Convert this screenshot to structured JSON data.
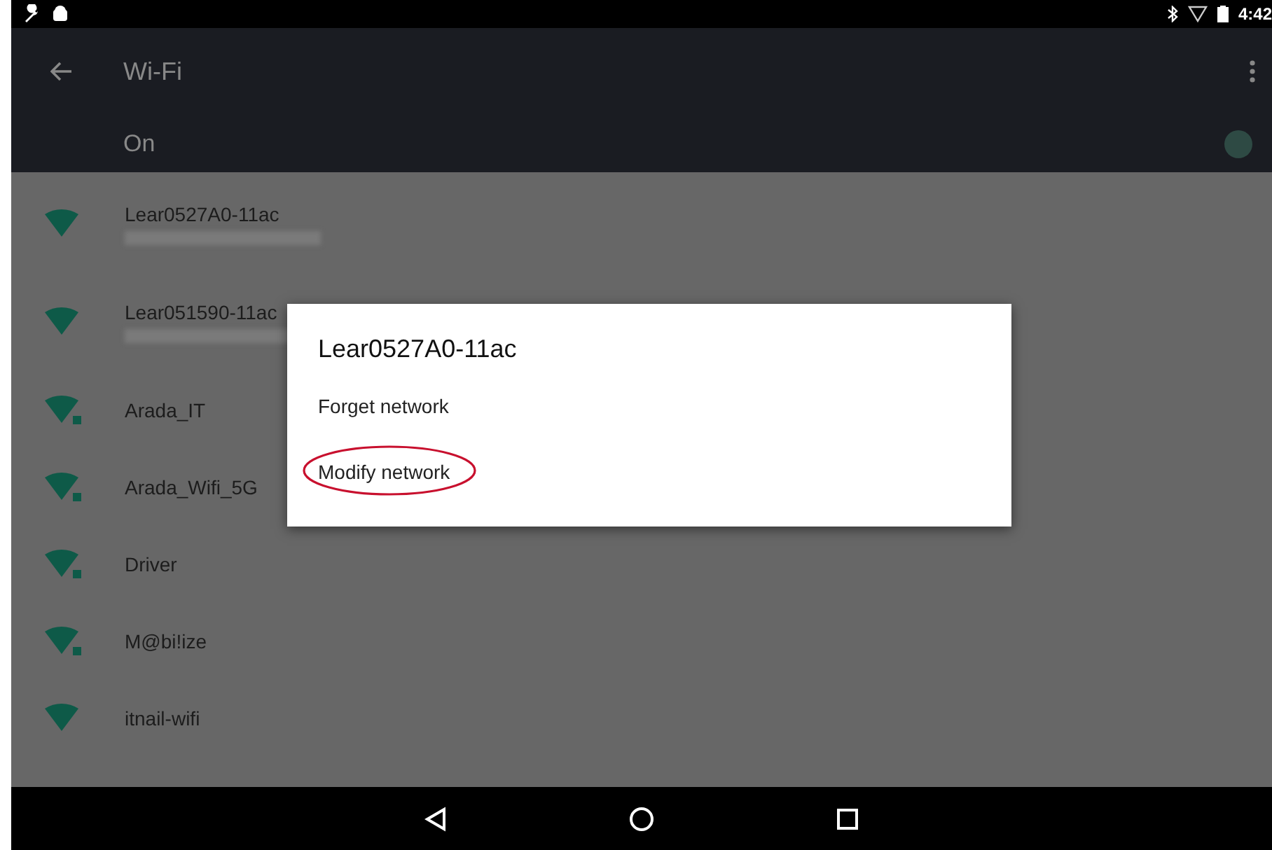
{
  "status_bar": {
    "time": "4:42"
  },
  "toolbar": {
    "title": "Wi-Fi"
  },
  "master_switch": {
    "label": "On",
    "on": true
  },
  "networks": [
    {
      "name": "Lear0527A0-11ac",
      "secured": false,
      "has_detail": true
    },
    {
      "name": "Lear051590-11ac",
      "secured": false,
      "has_detail": true
    },
    {
      "name": "Arada_IT",
      "secured": true,
      "has_detail": false
    },
    {
      "name": "Arada_Wifi_5G",
      "secured": true,
      "has_detail": false
    },
    {
      "name": "Driver",
      "secured": true,
      "has_detail": false
    },
    {
      "name": "M@bi!ize",
      "secured": true,
      "has_detail": false
    },
    {
      "name": "itnail-wifi",
      "secured": false,
      "has_detail": false
    }
  ],
  "dialog": {
    "title": "Lear0527A0-11ac",
    "options": [
      {
        "label": "Forget network",
        "circled": false
      },
      {
        "label": "Modify network",
        "circled": true
      }
    ]
  }
}
